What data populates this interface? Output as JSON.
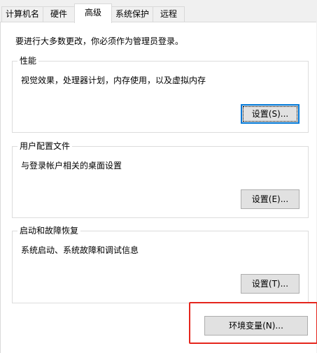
{
  "tabs": [
    "计算机名",
    "硬件",
    "高级",
    "系统保护",
    "远程"
  ],
  "active_tab": "高级",
  "intro": "要进行大多数更改，你必须作为管理员登录。",
  "performance": {
    "title": "性能",
    "description": "视觉效果，处理器计划，内存使用，以及虚拟内存",
    "button": "设置(S)..."
  },
  "user_profiles": {
    "title": "用户配置文件",
    "description": "与登录帐户相关的桌面设置",
    "button": "设置(E)..."
  },
  "startup_recovery": {
    "title": "启动和故障恢复",
    "description": "系统启动、系统故障和调试信息",
    "button": "设置(T)..."
  },
  "env_vars_button": "环境变量(N)...",
  "colors": {
    "highlight_border": "#e5251c",
    "focus_border": "#0078d7",
    "button_bg": "#e1e1e1"
  }
}
